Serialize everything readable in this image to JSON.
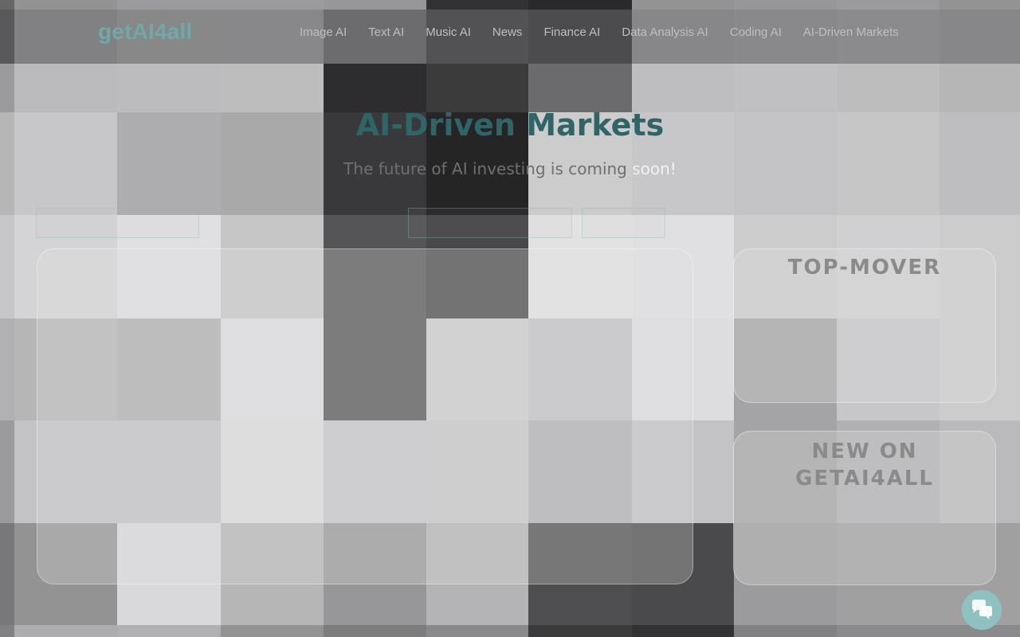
{
  "logo": "getAI4all",
  "nav": [
    {
      "label": "Image AI"
    },
    {
      "label": "Text AI"
    },
    {
      "label": "Music AI"
    },
    {
      "label": "News"
    },
    {
      "label": "Finance AI"
    },
    {
      "label": "Data Analysis AI"
    },
    {
      "label": "Coding AI"
    },
    {
      "label": "AI-Driven Markets"
    }
  ],
  "hero": {
    "title": "AI-Driven Markets",
    "subtitle_main": "The future of AI investing is coming ",
    "subtitle_end": "soon!"
  },
  "panels": {
    "top_mover_title": "TOP-MOVER",
    "new_on_title": "NEW ON GETAI4ALL"
  },
  "icons": {
    "chat": "chat-bubbles-icon"
  },
  "colors": {
    "accent": "#6fa9a8",
    "title": "#2f6566",
    "chat_button": "#8fc1c0"
  }
}
